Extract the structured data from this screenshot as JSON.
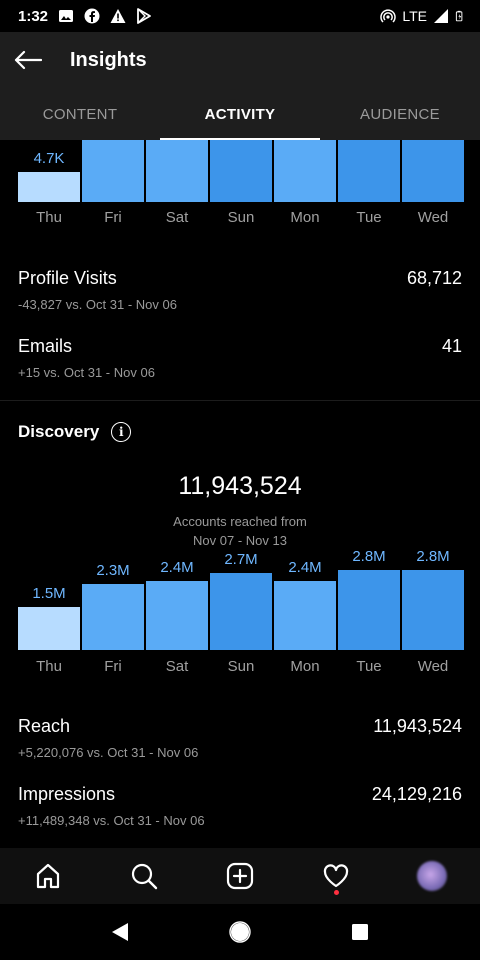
{
  "status_bar": {
    "time": "1:32",
    "network": "LTE"
  },
  "header": {
    "title": "Insights"
  },
  "tabs": [
    {
      "label": "CONTENT"
    },
    {
      "label": "ACTIVITY"
    },
    {
      "label": "AUDIENCE"
    }
  ],
  "interactions_chart": {
    "days": [
      "Thu",
      "Fri",
      "Sat",
      "Sun",
      "Mon",
      "Tue",
      "Wed"
    ],
    "top_label": "4.7K"
  },
  "metrics_top": [
    {
      "name": "Profile Visits",
      "value": "68,712",
      "sub": "-43,827 vs. Oct 31 - Nov 06"
    },
    {
      "name": "Emails",
      "value": "41",
      "sub": "+15 vs. Oct 31 - Nov 06"
    }
  ],
  "discovery": {
    "title": "Discovery",
    "total": "11,943,524",
    "caption_line1": "Accounts reached from",
    "caption_line2": "Nov 07 - Nov 13"
  },
  "chart_data": {
    "type": "bar",
    "categories": [
      "Thu",
      "Fri",
      "Sat",
      "Sun",
      "Mon",
      "Tue",
      "Wed"
    ],
    "values": [
      1.5,
      2.3,
      2.4,
      2.7,
      2.4,
      2.8,
      2.8
    ],
    "value_labels": [
      "1.5M",
      "2.3M",
      "2.4M",
      "2.7M",
      "2.4M",
      "2.8M",
      "2.8M"
    ],
    "ylabel": "",
    "ylim": [
      0,
      2.8
    ],
    "grid": false
  },
  "metrics_bottom": [
    {
      "name": "Reach",
      "value": "11,943,524",
      "sub": "+5,220,076 vs. Oct 31 - Nov 06"
    },
    {
      "name": "Impressions",
      "value": "24,129,216",
      "sub": "+11,489,348 vs. Oct 31 - Nov 06"
    }
  ],
  "colors": {
    "bar_highlight": "#3d95ea",
    "bar_normal": "#5aabf6",
    "bar_first": "#b7dcff",
    "value_label": "#6fb7ff",
    "accent_dot": "#ff3040"
  },
  "bottom_nav": [
    "home-icon",
    "search-icon",
    "add-post-icon",
    "heart-icon",
    "profile-avatar"
  ],
  "system_nav": [
    "back-triangle-icon",
    "home-circle-icon",
    "recents-square-icon"
  ]
}
